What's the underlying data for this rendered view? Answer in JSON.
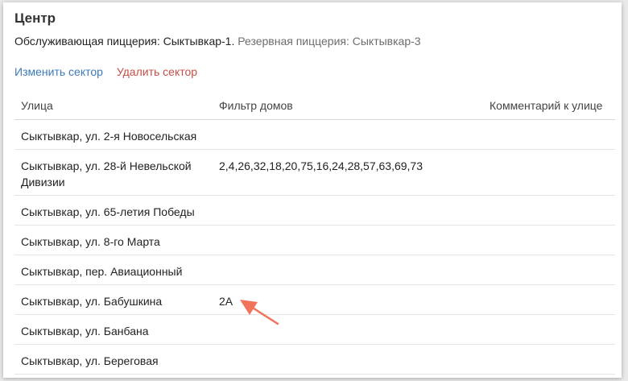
{
  "sector": {
    "title": "Центр",
    "serving_label": "Обслуживающая пиццерия: Сыктывкар-1.",
    "reserve_label": "Резервная пиццерия: Сыктывкар-3"
  },
  "actions": {
    "edit_label": "Изменить сектор",
    "delete_label": "Удалить сектор"
  },
  "table": {
    "headers": {
      "street": "Улица",
      "filter": "Фильтр домов",
      "comment": "Комментарий к улице"
    },
    "rows": [
      {
        "street": "Сыктывкар, ул. 2-я Новосельская",
        "filter": "",
        "comment": ""
      },
      {
        "street": "Сыктывкар, ул. 28-й Невельской Дивизии",
        "filter": "2,4,26,32,18,20,75,16,24,28,57,63,69,73",
        "comment": ""
      },
      {
        "street": "Сыктывкар, ул. 65-летия Победы",
        "filter": "",
        "comment": ""
      },
      {
        "street": "Сыктывкар, ул. 8-го Марта",
        "filter": "",
        "comment": ""
      },
      {
        "street": "Сыктывкар, пер. Авиационный",
        "filter": "",
        "comment": ""
      },
      {
        "street": "Сыктывкар, ул. Бабушкина",
        "filter": "2А",
        "comment": ""
      },
      {
        "street": "Сыктывкар, ул. Банбана",
        "filter": "",
        "comment": ""
      },
      {
        "street": "Сыктывкар, ул. Береговая",
        "filter": "",
        "comment": ""
      }
    ]
  },
  "colors": {
    "link_blue": "#3d7ab7",
    "link_red": "#c54f45",
    "annotation_arrow": "#f0735c"
  },
  "annotation": {
    "icon": "arrow-annotation-icon"
  }
}
